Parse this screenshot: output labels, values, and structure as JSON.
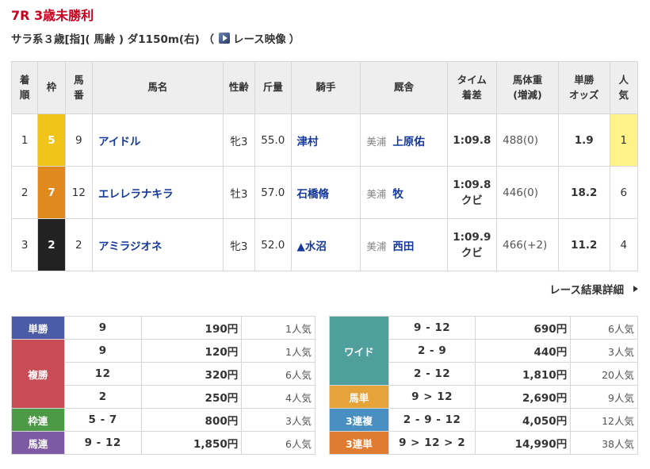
{
  "race": {
    "title": "7R 3歳未勝利",
    "conditions": "サラ系３歳[指]( 馬齢 ) ダ1150m(右) （",
    "video_label": "レース映像",
    "close_paren": "）"
  },
  "headers": {
    "rank": "着\n順",
    "waku": "枠",
    "num": "馬\n番",
    "name": "馬名",
    "sexage": "性齢",
    "weight": "斤量",
    "jockey": "騎手",
    "stable": "厩舎",
    "time": "タイム\n着差",
    "body": "馬体重\n(増減)",
    "odds": "単勝\nオッズ",
    "pop": "人\n気"
  },
  "rows": [
    {
      "rank": "1",
      "waku": "5",
      "waku_color": "#f0c419",
      "num": "9",
      "name": "アイドル",
      "sexage": "牝3",
      "weight": "55.0",
      "jockey": "津村",
      "stable_loc": "美浦",
      "stable": "上原佑",
      "time": "1:09.8",
      "margin": "",
      "body": "488(0)",
      "odds": "1.9",
      "pop": "1",
      "pop_highlight": true
    },
    {
      "rank": "2",
      "waku": "7",
      "waku_color": "#e08a1e",
      "num": "12",
      "name": "エレレラナキラ",
      "sexage": "牡3",
      "weight": "57.0",
      "jockey": "石橋脩",
      "stable_loc": "美浦",
      "stable": "牧",
      "time": "1:09.8",
      "margin": "クビ",
      "body": "446(0)",
      "odds": "18.2",
      "pop": "6",
      "pop_highlight": false
    },
    {
      "rank": "3",
      "waku": "2",
      "waku_color": "#222222",
      "num": "2",
      "name": "アミラジオネ",
      "sexage": "牝3",
      "weight": "52.0",
      "jockey": "▲水沼",
      "stable_loc": "美浦",
      "stable": "西田",
      "time": "1:09.9",
      "margin": "クビ",
      "body": "466(+2)",
      "odds": "11.2",
      "pop": "4",
      "pop_highlight": false
    }
  ],
  "detail_link": "レース結果詳細",
  "payouts_left": [
    {
      "label": "単勝",
      "color": "#4b5ba6",
      "entries": [
        {
          "nums": "9",
          "yen": "190円",
          "ninki": "1人気"
        }
      ]
    },
    {
      "label": "複勝",
      "color": "#c84c55",
      "entries": [
        {
          "nums": "9",
          "yen": "120円",
          "ninki": "1人気"
        },
        {
          "nums": "12",
          "yen": "320円",
          "ninki": "6人気"
        },
        {
          "nums": "2",
          "yen": "250円",
          "ninki": "4人気"
        }
      ]
    },
    {
      "label": "枠連",
      "color": "#4c9a45",
      "entries": [
        {
          "nums": "5 - 7",
          "yen": "800円",
          "ninki": "3人気"
        }
      ]
    },
    {
      "label": "馬連",
      "color": "#7d5aa3",
      "entries": [
        {
          "nums": "9 - 12",
          "yen": "1,850円",
          "ninki": "6人気"
        }
      ]
    }
  ],
  "payouts_right": [
    {
      "label": "ワイド",
      "color": "#4f9f9d",
      "entries": [
        {
          "nums": "9 - 12",
          "yen": "690円",
          "ninki": "6人気"
        },
        {
          "nums": "2 - 9",
          "yen": "440円",
          "ninki": "3人気"
        },
        {
          "nums": "2 - 12",
          "yen": "1,810円",
          "ninki": "20人気"
        }
      ]
    },
    {
      "label": "馬単",
      "color": "#e5a33a",
      "entries": [
        {
          "nums": "9 > 12",
          "yen": "2,690円",
          "ninki": "9人気"
        }
      ]
    },
    {
      "label": "3連複",
      "color": "#4a8fc2",
      "entries": [
        {
          "nums": "2 - 9 - 12",
          "yen": "4,050円",
          "ninki": "12人気"
        }
      ]
    },
    {
      "label": "3連単",
      "color": "#e07b32",
      "entries": [
        {
          "nums": "9 > 12 > 2",
          "yen": "14,990円",
          "ninki": "38人気"
        }
      ]
    }
  ]
}
